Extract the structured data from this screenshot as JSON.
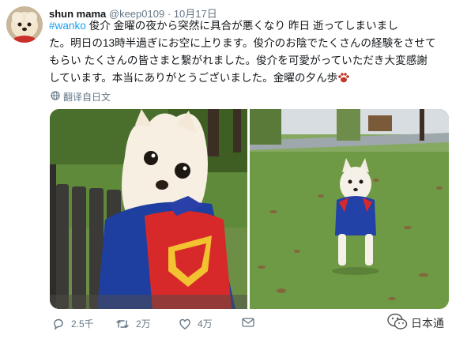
{
  "tweet": {
    "display_name": "shun mama",
    "handle": "@keep0109",
    "separator": "·",
    "date": "10月17日",
    "hashtag": "#wanko",
    "text_lines": [
      "俊介 金曜の夜から突然に具合が悪くなり 昨日 逝ってしまいまし",
      "た。明日の13時半過ぎにお空に上ります。俊介のお陰でたくさんの経験をさせて",
      "もらい たくさんの皆さまと繋がれました。俊介を可愛がっていただき大変感謝",
      "しています。本当にありがとうございました。金曜の夕ん歩"
    ],
    "translate_label": "翻译自日文",
    "photos": [
      {
        "description_icon": "photo-left"
      },
      {
        "description_icon": "photo-right"
      }
    ]
  },
  "actions": {
    "reply_count": "2.5千",
    "retweet_count": "2万",
    "like_count": "4万",
    "icons": [
      "reply-icon",
      "retweet-icon",
      "like-icon",
      "message-icon"
    ]
  },
  "watermark": {
    "label": "日本通"
  },
  "colors": {
    "link": "#1da1f2",
    "meta": "#657786",
    "text": "#14171a"
  }
}
